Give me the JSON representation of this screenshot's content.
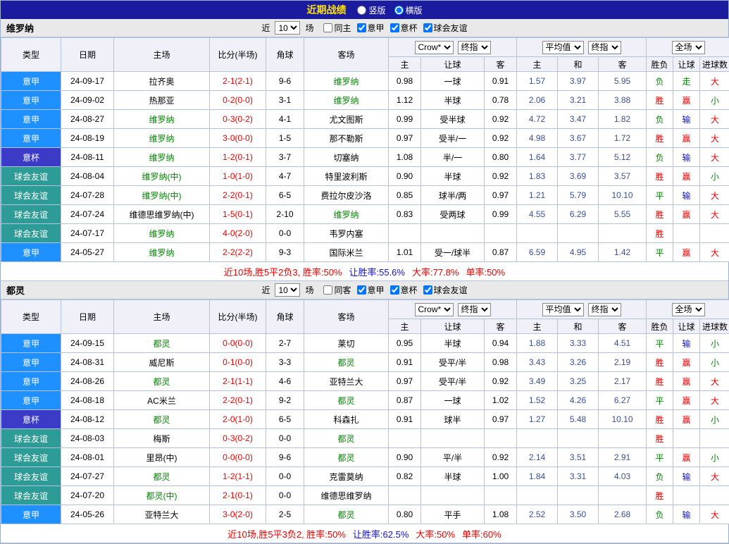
{
  "title_bar": {
    "title": "近期战绩",
    "radios": [
      {
        "label": "竖版",
        "selected": false
      },
      {
        "label": "横版",
        "selected": true
      }
    ]
  },
  "table_labels": {
    "columns": {
      "type": "类型",
      "date": "日期",
      "home": "主场",
      "score": "比分(半场)",
      "corner": "角球",
      "away": "客场"
    },
    "asian_selects": [
      "Crow*",
      "终指"
    ],
    "euro_selects": [
      "平均值",
      "终指"
    ],
    "result_select": "全场",
    "asian_cols": [
      "主",
      "让球",
      "客"
    ],
    "euro_cols": [
      "主",
      "和",
      "客"
    ],
    "result_cols": [
      "胜负",
      "让球",
      "进球数"
    ]
  },
  "colors": {
    "league": {
      "意甲": "#1E90FF",
      "意杯": "#3B3BC8",
      "球会友谊": "#2E9C96"
    },
    "result": {
      "r": "#E60000",
      "g": "#008800",
      "b": "#1010D0"
    },
    "score": "#E60000",
    "focal_team": "#008800",
    "euro_odds": "#3A4F96",
    "titlebar_bg": "#1B1BA0",
    "summary": {
      "red": "#E60000",
      "blue": "#1010D0"
    }
  },
  "sections": [
    {
      "team": "维罗纳",
      "filter": {
        "prefix": "近",
        "count": "10",
        "suffix": "场",
        "checkboxes": [
          {
            "label": "同主",
            "checked": false
          },
          {
            "label": "意甲",
            "checked": true
          },
          {
            "label": "意杯",
            "checked": true
          },
          {
            "label": "球会友谊",
            "checked": true
          }
        ]
      },
      "rows": [
        {
          "type": "意甲",
          "date": "24-09-17",
          "home": "拉齐奥",
          "hf": false,
          "score": "2-1(2-1)",
          "corner": "9-6",
          "away": "维罗纳",
          "af": true,
          "ah": "0.98",
          "hc": "一球",
          "aa": "0.91",
          "eh": "1.57",
          "ed": "3.97",
          "ea": "5.95",
          "res": [
            "负",
            "走",
            "大"
          ],
          "rc": [
            "g",
            "g",
            "r"
          ]
        },
        {
          "type": "意甲",
          "date": "24-09-02",
          "home": "热那亚",
          "hf": false,
          "score": "0-2(0-0)",
          "corner": "3-1",
          "away": "维罗纳",
          "af": true,
          "ah": "1.12",
          "hc": "半球",
          "aa": "0.78",
          "eh": "2.06",
          "ed": "3.21",
          "ea": "3.88",
          "res": [
            "胜",
            "赢",
            "小"
          ],
          "rc": [
            "r",
            "r",
            "g"
          ]
        },
        {
          "type": "意甲",
          "date": "24-08-27",
          "home": "维罗纳",
          "hf": true,
          "score": "0-3(0-2)",
          "corner": "4-1",
          "away": "尤文图斯",
          "af": false,
          "ah": "0.99",
          "hc": "受半球",
          "aa": "0.92",
          "eh": "4.72",
          "ed": "3.47",
          "ea": "1.82",
          "res": [
            "负",
            "输",
            "大"
          ],
          "rc": [
            "g",
            "b",
            "r"
          ]
        },
        {
          "type": "意甲",
          "date": "24-08-19",
          "home": "维罗纳",
          "hf": true,
          "score": "3-0(0-0)",
          "corner": "1-5",
          "away": "那不勒斯",
          "af": false,
          "ah": "0.97",
          "hc": "受半/一",
          "aa": "0.92",
          "eh": "4.98",
          "ed": "3.67",
          "ea": "1.72",
          "res": [
            "胜",
            "赢",
            "大"
          ],
          "rc": [
            "r",
            "r",
            "r"
          ]
        },
        {
          "type": "意杯",
          "date": "24-08-11",
          "home": "维罗纳",
          "hf": true,
          "score": "1-2(0-1)",
          "corner": "3-7",
          "away": "切塞纳",
          "af": false,
          "ah": "1.08",
          "hc": "半/一",
          "aa": "0.80",
          "eh": "1.64",
          "ed": "3.77",
          "ea": "5.12",
          "res": [
            "负",
            "输",
            "大"
          ],
          "rc": [
            "g",
            "b",
            "r"
          ]
        },
        {
          "type": "球会友谊",
          "date": "24-08-04",
          "home": "维罗纳(中)",
          "hf": true,
          "score": "1-0(1-0)",
          "corner": "4-7",
          "away": "特里波利斯",
          "af": false,
          "ah": "0.90",
          "hc": "半球",
          "aa": "0.92",
          "eh": "1.83",
          "ed": "3.69",
          "ea": "3.57",
          "res": [
            "胜",
            "赢",
            "小"
          ],
          "rc": [
            "r",
            "r",
            "g"
          ]
        },
        {
          "type": "球会友谊",
          "date": "24-07-28",
          "home": "维罗纳(中)",
          "hf": true,
          "score": "2-2(0-1)",
          "corner": "6-5",
          "away": "费拉尔皮沙洛",
          "af": false,
          "ah": "0.85",
          "hc": "球半/两",
          "aa": "0.97",
          "eh": "1.21",
          "ed": "5.79",
          "ea": "10.10",
          "res": [
            "平",
            "输",
            "大"
          ],
          "rc": [
            "g",
            "b",
            "r"
          ]
        },
        {
          "type": "球会友谊",
          "date": "24-07-24",
          "home": "维德思维罗纳(中)",
          "hf": false,
          "score": "1-5(0-1)",
          "corner": "2-10",
          "away": "维罗纳",
          "af": true,
          "ah": "0.83",
          "hc": "受两球",
          "aa": "0.99",
          "eh": "4.55",
          "ed": "6.29",
          "ea": "5.55",
          "res": [
            "胜",
            "赢",
            "大"
          ],
          "rc": [
            "r",
            "r",
            "r"
          ]
        },
        {
          "type": "球会友谊",
          "date": "24-07-17",
          "home": "维罗纳",
          "hf": true,
          "score": "4-0(2-0)",
          "corner": "0-0",
          "away": "韦罗内塞",
          "af": false,
          "ah": "",
          "hc": "",
          "aa": "",
          "eh": "",
          "ed": "",
          "ea": "",
          "res": [
            "胜",
            "",
            ""
          ],
          "rc": [
            "r",
            "",
            ""
          ]
        },
        {
          "type": "意甲",
          "date": "24-05-27",
          "home": "维罗纳",
          "hf": true,
          "score": "2-2(2-2)",
          "corner": "9-3",
          "away": "国际米兰",
          "af": false,
          "ah": "1.01",
          "hc": "受一/球半",
          "aa": "0.87",
          "eh": "6.59",
          "ed": "4.95",
          "ea": "1.42",
          "res": [
            "平",
            "赢",
            "大"
          ],
          "rc": [
            "g",
            "r",
            "r"
          ]
        }
      ],
      "summary": [
        {
          "text": "近10场,胜5平2负3, 胜率:50%",
          "c": "red"
        },
        {
          "text": "让胜率:55.6%",
          "c": "blue"
        },
        {
          "text": "大率:77.8%",
          "c": "red"
        },
        {
          "text": "单率:50%",
          "c": "red"
        }
      ]
    },
    {
      "team": "都灵",
      "filter": {
        "prefix": "近",
        "count": "10",
        "suffix": "场",
        "checkboxes": [
          {
            "label": "同客",
            "checked": false
          },
          {
            "label": "意甲",
            "checked": true
          },
          {
            "label": "意杯",
            "checked": true
          },
          {
            "label": "球会友谊",
            "checked": true
          }
        ]
      },
      "rows": [
        {
          "type": "意甲",
          "date": "24-09-15",
          "home": "都灵",
          "hf": true,
          "score": "0-0(0-0)",
          "corner": "2-7",
          "away": "莱切",
          "af": false,
          "ah": "0.95",
          "hc": "半球",
          "aa": "0.94",
          "eh": "1.88",
          "ed": "3.33",
          "ea": "4.51",
          "res": [
            "平",
            "输",
            "小"
          ],
          "rc": [
            "g",
            "b",
            "g"
          ]
        },
        {
          "type": "意甲",
          "date": "24-08-31",
          "home": "威尼斯",
          "hf": false,
          "score": "0-1(0-0)",
          "corner": "3-3",
          "away": "都灵",
          "af": true,
          "ah": "0.91",
          "hc": "受平/半",
          "aa": "0.98",
          "eh": "3.43",
          "ed": "3.26",
          "ea": "2.19",
          "res": [
            "胜",
            "赢",
            "小"
          ],
          "rc": [
            "r",
            "r",
            "g"
          ]
        },
        {
          "type": "意甲",
          "date": "24-08-26",
          "home": "都灵",
          "hf": true,
          "score": "2-1(1-1)",
          "corner": "4-6",
          "away": "亚特兰大",
          "af": false,
          "ah": "0.97",
          "hc": "受平/半",
          "aa": "0.92",
          "eh": "3.49",
          "ed": "3.25",
          "ea": "2.17",
          "res": [
            "胜",
            "赢",
            "大"
          ],
          "rc": [
            "r",
            "r",
            "r"
          ]
        },
        {
          "type": "意甲",
          "date": "24-08-18",
          "home": "AC米兰",
          "hf": false,
          "score": "2-2(0-1)",
          "corner": "9-2",
          "away": "都灵",
          "af": true,
          "ah": "0.87",
          "hc": "一球",
          "aa": "1.02",
          "eh": "1.52",
          "ed": "4.26",
          "ea": "6.27",
          "res": [
            "平",
            "赢",
            "大"
          ],
          "rc": [
            "g",
            "r",
            "r"
          ]
        },
        {
          "type": "意杯",
          "date": "24-08-12",
          "home": "都灵",
          "hf": true,
          "score": "2-0(1-0)",
          "corner": "6-5",
          "away": "科森扎",
          "af": false,
          "ah": "0.91",
          "hc": "球半",
          "aa": "0.97",
          "eh": "1.27",
          "ed": "5.48",
          "ea": "10.10",
          "res": [
            "胜",
            "赢",
            "小"
          ],
          "rc": [
            "r",
            "r",
            "g"
          ]
        },
        {
          "type": "球会友谊",
          "date": "24-08-03",
          "home": "梅斯",
          "hf": false,
          "score": "0-3(0-2)",
          "corner": "0-0",
          "away": "都灵",
          "af": true,
          "ah": "",
          "hc": "",
          "aa": "",
          "eh": "",
          "ed": "",
          "ea": "",
          "res": [
            "胜",
            "",
            ""
          ],
          "rc": [
            "r",
            "",
            ""
          ]
        },
        {
          "type": "球会友谊",
          "date": "24-08-01",
          "home": "里昂(中)",
          "hf": false,
          "score": "0-0(0-0)",
          "corner": "9-6",
          "away": "都灵",
          "af": true,
          "ah": "0.90",
          "hc": "平/半",
          "aa": "0.92",
          "eh": "2.14",
          "ed": "3.51",
          "ea": "2.91",
          "res": [
            "平",
            "赢",
            "小"
          ],
          "rc": [
            "g",
            "r",
            "g"
          ]
        },
        {
          "type": "球会友谊",
          "date": "24-07-27",
          "home": "都灵",
          "hf": true,
          "score": "1-2(1-1)",
          "corner": "0-0",
          "away": "克雷莫纳",
          "af": false,
          "ah": "0.82",
          "hc": "半球",
          "aa": "1.00",
          "eh": "1.84",
          "ed": "3.31",
          "ea": "4.03",
          "res": [
            "负",
            "输",
            "大"
          ],
          "rc": [
            "g",
            "b",
            "r"
          ]
        },
        {
          "type": "球会友谊",
          "date": "24-07-20",
          "home": "都灵(中)",
          "hf": true,
          "score": "2-1(0-1)",
          "corner": "0-0",
          "away": "维德思维罗纳",
          "af": false,
          "ah": "",
          "hc": "",
          "aa": "",
          "eh": "",
          "ed": "",
          "ea": "",
          "res": [
            "胜",
            "",
            ""
          ],
          "rc": [
            "r",
            "",
            ""
          ]
        },
        {
          "type": "意甲",
          "date": "24-05-26",
          "home": "亚特兰大",
          "hf": false,
          "score": "3-0(2-0)",
          "corner": "2-5",
          "away": "都灵",
          "af": true,
          "ah": "0.80",
          "hc": "平手",
          "aa": "1.08",
          "eh": "2.52",
          "ed": "3.50",
          "ea": "2.68",
          "res": [
            "负",
            "输",
            "大"
          ],
          "rc": [
            "g",
            "b",
            "r"
          ]
        }
      ],
      "summary": [
        {
          "text": "近10场,胜5平3负2, 胜率:50%",
          "c": "red"
        },
        {
          "text": "让胜率:62.5%",
          "c": "blue"
        },
        {
          "text": "大率:50%",
          "c": "red"
        },
        {
          "text": "单率:60%",
          "c": "red"
        }
      ]
    }
  ]
}
